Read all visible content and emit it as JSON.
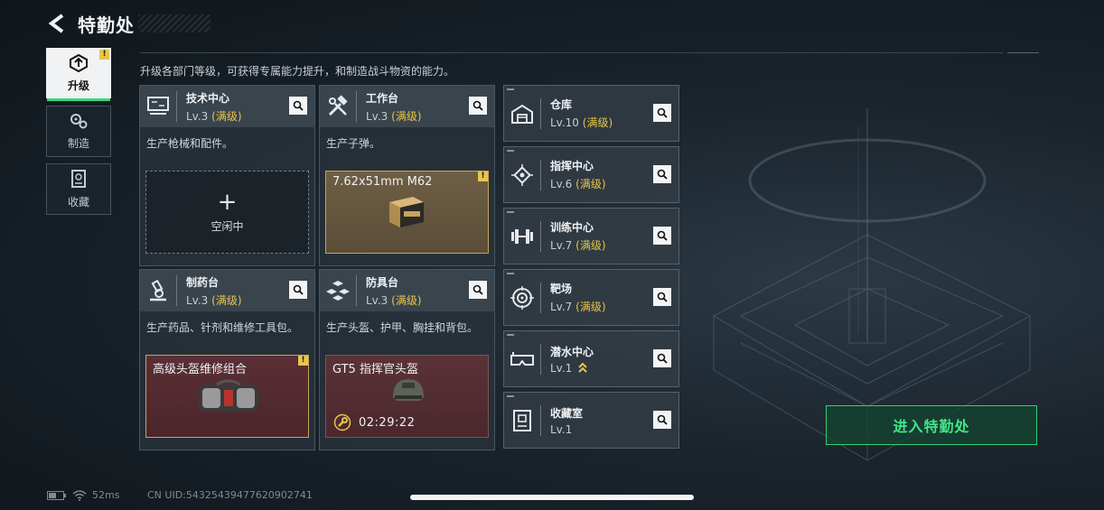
{
  "header": {
    "title": "特勤处"
  },
  "sidebar": {
    "items": [
      {
        "label": "升级",
        "icon": "upgrade-icon",
        "active": true,
        "badge": "!"
      },
      {
        "label": "制造",
        "icon": "gears-icon",
        "active": false
      },
      {
        "label": "收藏",
        "icon": "collection-icon",
        "active": false
      }
    ]
  },
  "description": "升级各部门等级，可获得专属能力提升，和制造战斗物资的能力。",
  "facilities": [
    {
      "name": "技术中心",
      "level": "Lv.3",
      "maxed": "(满级)",
      "icon": "tech-center-icon",
      "desc": "生产枪械和配件。",
      "slot": {
        "state": "idle",
        "plus": "+",
        "label": "空闲中"
      }
    },
    {
      "name": "工作台",
      "level": "Lv.3",
      "maxed": "(满级)",
      "icon": "hammer-wrench-icon",
      "desc": "生产子弹。",
      "slot": {
        "state": "item",
        "item_name": "7.62x51mm M62",
        "badge": "!"
      }
    },
    {
      "name": "制药台",
      "level": "Lv.3",
      "maxed": "(满级)",
      "icon": "microscope-icon",
      "desc": "生产药品、针剂和维修工具包。",
      "slot": {
        "state": "item",
        "item_name": "高级头盔维修组合",
        "badge": "!"
      }
    },
    {
      "name": "防具台",
      "level": "Lv.3",
      "maxed": "(满级)",
      "icon": "armor-blocks-icon",
      "desc": "生产头盔、护甲、胸挂和背包。",
      "slot": {
        "state": "item",
        "item_name": "GT5 指挥官头盔",
        "timer": "02:29:22"
      }
    }
  ],
  "rooms": [
    {
      "name": "仓库",
      "level": "Lv.10",
      "maxed": "(满级)",
      "icon": "warehouse-icon"
    },
    {
      "name": "指挥中心",
      "level": "Lv.6",
      "maxed": "(满级)",
      "icon": "chip-icon"
    },
    {
      "name": "训练中心",
      "level": "Lv.7",
      "maxed": "(满级)",
      "icon": "dumbbell-icon"
    },
    {
      "name": "靶场",
      "level": "Lv.7",
      "maxed": "(满级)",
      "icon": "target-icon"
    },
    {
      "name": "潜水中心",
      "level": "Lv.1",
      "maxed": "",
      "icon": "goggles-icon",
      "upgrade_icon": "chevron-up-double-icon"
    },
    {
      "name": "收藏室",
      "level": "Lv.1",
      "maxed": "",
      "icon": "trophy-cabinet-icon"
    }
  ],
  "enter_button": {
    "label": "进入特勤处"
  },
  "status": {
    "ping": "52ms",
    "uid": "CN UID:54325439477620902741"
  },
  "colors": {
    "accent_green": "#37d67a",
    "gold": "#e8c54a",
    "panel": "#39444d"
  }
}
